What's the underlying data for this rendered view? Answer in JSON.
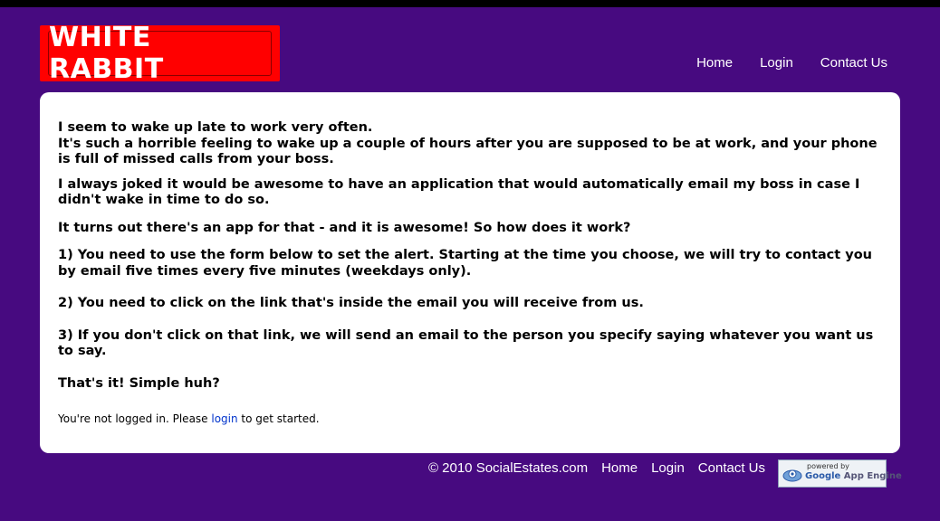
{
  "brand": {
    "logo_text": "WHITE RABBIT",
    "background": "#470a80",
    "logo_color": "#ff0000"
  },
  "nav": {
    "home": "Home",
    "login": "Login",
    "contact": "Contact Us"
  },
  "content": {
    "line1": "I seem to wake up late to work very often.",
    "line2": "It's such a horrible feeling to wake up a couple of hours after you are supposed to be at work, and your phone is full of missed calls from your boss.",
    "line3": "I always joked it would be awesome to have an application that would automatically email my boss in case I didn't wake in time to do so.",
    "line4": "It turns out there's an app for that - and it is awesome! So how does it work?",
    "step1": "1) You need to use the form below to set the alert. Starting at the time you choose, we will try to contact you by email five times every five minutes (weekdays only).",
    "step2": "2) You need to click on the link that's inside the email you will receive from us.",
    "step3": "3) If you don't click on that link, we will send an email to the person you specify saying whatever you want us to say.",
    "closing": "That's it! Simple huh?"
  },
  "status": {
    "prefix": "You're not logged in. Please ",
    "link": "login",
    "suffix": " to get started."
  },
  "footer": {
    "copyright": "© 2010 SocialEstates.com",
    "home": "Home",
    "login": "Login",
    "contact": "Contact Us"
  },
  "badge": {
    "small": "powered by",
    "main_google": "Google",
    "main_rest": " App Engine",
    "icon": "app-engine-icon"
  }
}
